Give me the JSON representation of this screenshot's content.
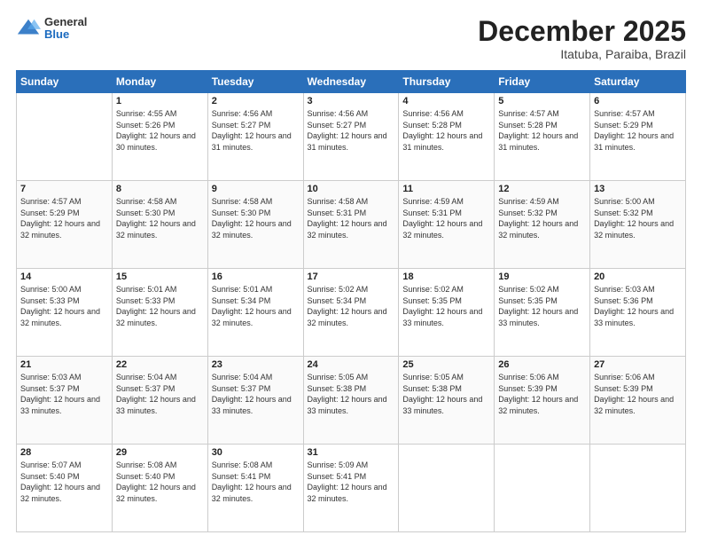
{
  "header": {
    "logo": {
      "general": "General",
      "blue": "Blue"
    },
    "month": "December 2025",
    "location": "Itatuba, Paraiba, Brazil"
  },
  "days_of_week": [
    "Sunday",
    "Monday",
    "Tuesday",
    "Wednesday",
    "Thursday",
    "Friday",
    "Saturday"
  ],
  "weeks": [
    [
      {
        "day": "",
        "sunrise": "",
        "sunset": "",
        "daylight": ""
      },
      {
        "day": "1",
        "sunrise": "Sunrise: 4:55 AM",
        "sunset": "Sunset: 5:26 PM",
        "daylight": "Daylight: 12 hours and 30 minutes."
      },
      {
        "day": "2",
        "sunrise": "Sunrise: 4:56 AM",
        "sunset": "Sunset: 5:27 PM",
        "daylight": "Daylight: 12 hours and 31 minutes."
      },
      {
        "day": "3",
        "sunrise": "Sunrise: 4:56 AM",
        "sunset": "Sunset: 5:27 PM",
        "daylight": "Daylight: 12 hours and 31 minutes."
      },
      {
        "day": "4",
        "sunrise": "Sunrise: 4:56 AM",
        "sunset": "Sunset: 5:28 PM",
        "daylight": "Daylight: 12 hours and 31 minutes."
      },
      {
        "day": "5",
        "sunrise": "Sunrise: 4:57 AM",
        "sunset": "Sunset: 5:28 PM",
        "daylight": "Daylight: 12 hours and 31 minutes."
      },
      {
        "day": "6",
        "sunrise": "Sunrise: 4:57 AM",
        "sunset": "Sunset: 5:29 PM",
        "daylight": "Daylight: 12 hours and 31 minutes."
      }
    ],
    [
      {
        "day": "7",
        "sunrise": "Sunrise: 4:57 AM",
        "sunset": "Sunset: 5:29 PM",
        "daylight": "Daylight: 12 hours and 32 minutes."
      },
      {
        "day": "8",
        "sunrise": "Sunrise: 4:58 AM",
        "sunset": "Sunset: 5:30 PM",
        "daylight": "Daylight: 12 hours and 32 minutes."
      },
      {
        "day": "9",
        "sunrise": "Sunrise: 4:58 AM",
        "sunset": "Sunset: 5:30 PM",
        "daylight": "Daylight: 12 hours and 32 minutes."
      },
      {
        "day": "10",
        "sunrise": "Sunrise: 4:58 AM",
        "sunset": "Sunset: 5:31 PM",
        "daylight": "Daylight: 12 hours and 32 minutes."
      },
      {
        "day": "11",
        "sunrise": "Sunrise: 4:59 AM",
        "sunset": "Sunset: 5:31 PM",
        "daylight": "Daylight: 12 hours and 32 minutes."
      },
      {
        "day": "12",
        "sunrise": "Sunrise: 4:59 AM",
        "sunset": "Sunset: 5:32 PM",
        "daylight": "Daylight: 12 hours and 32 minutes."
      },
      {
        "day": "13",
        "sunrise": "Sunrise: 5:00 AM",
        "sunset": "Sunset: 5:32 PM",
        "daylight": "Daylight: 12 hours and 32 minutes."
      }
    ],
    [
      {
        "day": "14",
        "sunrise": "Sunrise: 5:00 AM",
        "sunset": "Sunset: 5:33 PM",
        "daylight": "Daylight: 12 hours and 32 minutes."
      },
      {
        "day": "15",
        "sunrise": "Sunrise: 5:01 AM",
        "sunset": "Sunset: 5:33 PM",
        "daylight": "Daylight: 12 hours and 32 minutes."
      },
      {
        "day": "16",
        "sunrise": "Sunrise: 5:01 AM",
        "sunset": "Sunset: 5:34 PM",
        "daylight": "Daylight: 12 hours and 32 minutes."
      },
      {
        "day": "17",
        "sunrise": "Sunrise: 5:02 AM",
        "sunset": "Sunset: 5:34 PM",
        "daylight": "Daylight: 12 hours and 32 minutes."
      },
      {
        "day": "18",
        "sunrise": "Sunrise: 5:02 AM",
        "sunset": "Sunset: 5:35 PM",
        "daylight": "Daylight: 12 hours and 33 minutes."
      },
      {
        "day": "19",
        "sunrise": "Sunrise: 5:02 AM",
        "sunset": "Sunset: 5:35 PM",
        "daylight": "Daylight: 12 hours and 33 minutes."
      },
      {
        "day": "20",
        "sunrise": "Sunrise: 5:03 AM",
        "sunset": "Sunset: 5:36 PM",
        "daylight": "Daylight: 12 hours and 33 minutes."
      }
    ],
    [
      {
        "day": "21",
        "sunrise": "Sunrise: 5:03 AM",
        "sunset": "Sunset: 5:37 PM",
        "daylight": "Daylight: 12 hours and 33 minutes."
      },
      {
        "day": "22",
        "sunrise": "Sunrise: 5:04 AM",
        "sunset": "Sunset: 5:37 PM",
        "daylight": "Daylight: 12 hours and 33 minutes."
      },
      {
        "day": "23",
        "sunrise": "Sunrise: 5:04 AM",
        "sunset": "Sunset: 5:37 PM",
        "daylight": "Daylight: 12 hours and 33 minutes."
      },
      {
        "day": "24",
        "sunrise": "Sunrise: 5:05 AM",
        "sunset": "Sunset: 5:38 PM",
        "daylight": "Daylight: 12 hours and 33 minutes."
      },
      {
        "day": "25",
        "sunrise": "Sunrise: 5:05 AM",
        "sunset": "Sunset: 5:38 PM",
        "daylight": "Daylight: 12 hours and 33 minutes."
      },
      {
        "day": "26",
        "sunrise": "Sunrise: 5:06 AM",
        "sunset": "Sunset: 5:39 PM",
        "daylight": "Daylight: 12 hours and 32 minutes."
      },
      {
        "day": "27",
        "sunrise": "Sunrise: 5:06 AM",
        "sunset": "Sunset: 5:39 PM",
        "daylight": "Daylight: 12 hours and 32 minutes."
      }
    ],
    [
      {
        "day": "28",
        "sunrise": "Sunrise: 5:07 AM",
        "sunset": "Sunset: 5:40 PM",
        "daylight": "Daylight: 12 hours and 32 minutes."
      },
      {
        "day": "29",
        "sunrise": "Sunrise: 5:08 AM",
        "sunset": "Sunset: 5:40 PM",
        "daylight": "Daylight: 12 hours and 32 minutes."
      },
      {
        "day": "30",
        "sunrise": "Sunrise: 5:08 AM",
        "sunset": "Sunset: 5:41 PM",
        "daylight": "Daylight: 12 hours and 32 minutes."
      },
      {
        "day": "31",
        "sunrise": "Sunrise: 5:09 AM",
        "sunset": "Sunset: 5:41 PM",
        "daylight": "Daylight: 12 hours and 32 minutes."
      },
      {
        "day": "",
        "sunrise": "",
        "sunset": "",
        "daylight": ""
      },
      {
        "day": "",
        "sunrise": "",
        "sunset": "",
        "daylight": ""
      },
      {
        "day": "",
        "sunrise": "",
        "sunset": "",
        "daylight": ""
      }
    ]
  ]
}
